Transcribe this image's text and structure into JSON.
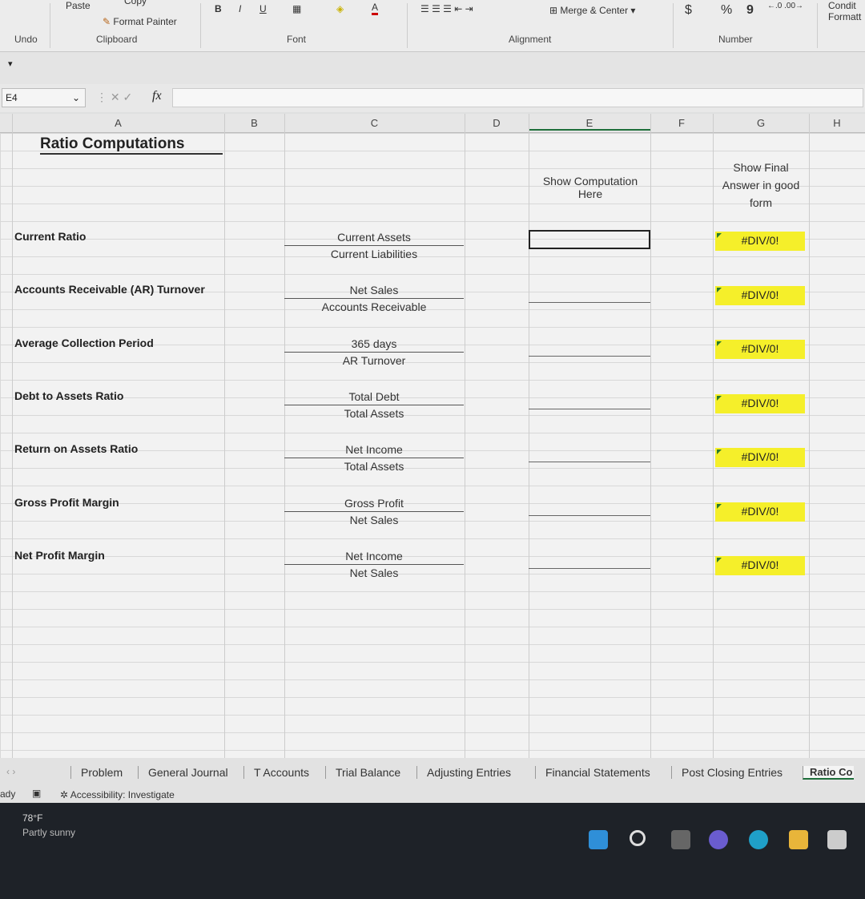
{
  "ribbon": {
    "undo": "Undo",
    "paste": "Paste",
    "copy": "Copy",
    "format_painter": "Format Painter",
    "clipboard": "Clipboard",
    "bold": "B",
    "italic": "I",
    "underline": "U",
    "font": "Font",
    "alignment": "Alignment",
    "merge_center": "Merge & Center",
    "number": "Number",
    "dollar": "$",
    "percent": "%",
    "comma": "9",
    "conditional": "Condit",
    "formatting": "Formatt"
  },
  "formula_bar": {
    "name_box": "E4",
    "fx": "fx",
    "value": ""
  },
  "columns": [
    "A",
    "B",
    "C",
    "D",
    "E",
    "F",
    "G",
    "H"
  ],
  "sheet": {
    "title": "Ratio Computations",
    "header_e": "Show Computation Here",
    "header_g": "Show Final Answer in good form",
    "ratios": [
      {
        "label": "Current Ratio",
        "numerator": "Current Assets",
        "denominator": "Current Liabilities",
        "result": "#DIV/0!"
      },
      {
        "label": "Accounts Receivable (AR) Turnover",
        "numerator": "Net Sales",
        "denominator": "Accounts Receivable",
        "result": "#DIV/0!"
      },
      {
        "label": "Average Collection Period",
        "numerator": "365 days",
        "denominator": "AR Turnover",
        "result": "#DIV/0!"
      },
      {
        "label": "Debt to Assets Ratio",
        "numerator": "Total Debt",
        "denominator": "Total Assets",
        "result": "#DIV/0!"
      },
      {
        "label": "Return on Assets Ratio",
        "numerator": "Net Income",
        "denominator": "Total Assets",
        "result": "#DIV/0!"
      },
      {
        "label": "Gross Profit Margin",
        "numerator": "Gross Profit",
        "denominator": "Net Sales",
        "result": "#DIV/0!"
      },
      {
        "label": "Net Profit Margin",
        "numerator": "Net Income",
        "denominator": "Net Sales",
        "result": "#DIV/0!"
      }
    ],
    "highlight_color": "#f5ef2a"
  },
  "tabs": [
    "Problem",
    "General Journal",
    "T Accounts",
    "Trial Balance",
    "Adjusting Entries",
    "Financial Statements",
    "Post Closing Entries",
    "Ratio Co"
  ],
  "active_tab": "Ratio Co",
  "status": {
    "ready": "ady",
    "accessibility": "Accessibility: Investigate"
  },
  "taskbar": {
    "temp": "78°F",
    "weather": "Partly sunny"
  }
}
